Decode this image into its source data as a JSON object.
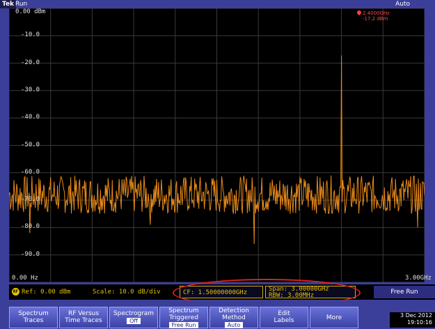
{
  "topbar": {
    "brand": "Tek",
    "state": "Run",
    "acq_mode": "Auto"
  },
  "chart_data": {
    "type": "line",
    "ylabel_ticks": [
      "0.00 dBm",
      "-10.0",
      "-20.0",
      "-30.0",
      "-40.0",
      "-50.0",
      "-60.0",
      "-70.0",
      "-80.0",
      "-90.0"
    ],
    "xlim_labels": [
      "0.00 Hz",
      "3.00GHz"
    ],
    "ylim": [
      -100,
      0
    ],
    "xlim": [
      0,
      3.0
    ],
    "x_unit": "GHz",
    "y_unit": "dBm",
    "noise_floor_dbm": -68,
    "peak": {
      "x": 2.4,
      "y": -17.2
    },
    "dips": [
      {
        "x": 0.15,
        "y": -82
      },
      {
        "x": 1.77,
        "y": -86
      },
      {
        "x": 1.02,
        "y": -79
      },
      {
        "x": 2.95,
        "y": -80
      }
    ],
    "grid": true,
    "trace_color": "#e88a1a"
  },
  "marker": {
    "freq": "2.4000GHz",
    "level": "-17.2 dBm"
  },
  "status": {
    "ref": "Ref: 0.00 dBm",
    "scale": "Scale: 10.0 dB/div",
    "cf": "CF: 1.50000000GHz",
    "span": "Span:  3.00000GHz",
    "rbw": "RBW:   3.00MHz",
    "free_run": "Free Run",
    "rf_label": "RF"
  },
  "menu": [
    {
      "line1": "Spectrum",
      "line2": "Traces",
      "sub": ""
    },
    {
      "line1": "RF Versus",
      "line2": "Time Traces",
      "sub": ""
    },
    {
      "line1": "Spectrogram",
      "line2": "",
      "sub": "Off"
    },
    {
      "line1": "Spectrum",
      "line2": "Triggered",
      "sub": "Free Run"
    },
    {
      "line1": "Detection",
      "line2": "Method",
      "sub": "Auto"
    },
    {
      "line1": "Edit",
      "line2": "Labels",
      "sub": ""
    },
    {
      "line1": "More",
      "line2": "",
      "sub": ""
    }
  ],
  "date": {
    "day": "3 Dec 2012",
    "time": "19:10:16"
  },
  "colors": {
    "trace": "#e88a1a",
    "grid": "#3a3a3a",
    "frame": "#3b3f9a",
    "status_text": "#e5c000",
    "highlight": "#e02020"
  }
}
